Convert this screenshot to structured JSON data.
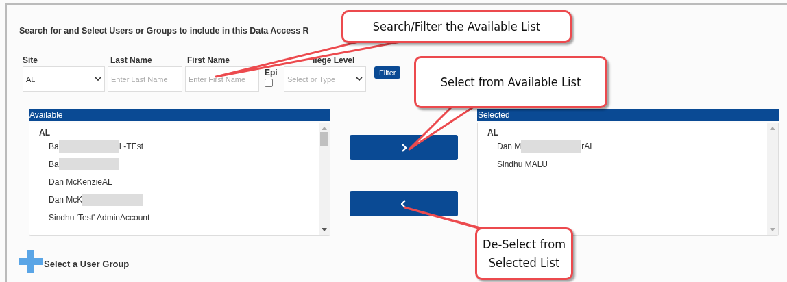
{
  "heading": "Search for and Select Users or Groups to include in this Data Access R",
  "filters": {
    "site": {
      "label": "Site",
      "value": "AL"
    },
    "last_name": {
      "label": "Last Name",
      "placeholder": "Enter Last Name"
    },
    "first_name": {
      "label": "First Name",
      "placeholder": "Enter First Name"
    },
    "epi": {
      "label": "Epi",
      "checked": false
    },
    "privilege": {
      "label": "ilege Level",
      "placeholder": "Select or Type"
    },
    "filter_button": "Filter"
  },
  "available": {
    "title": "Available",
    "groups": [
      {
        "name": "AL",
        "items": [
          {
            "prefix": "Ba",
            "redacted": true,
            "suffix": "L-TEst"
          },
          {
            "prefix": "Ba",
            "redacted": true
          },
          {
            "prefix": "Dan McKenzieAL",
            "redacted": false
          },
          {
            "prefix": "Dan McK",
            "redacted": true
          },
          {
            "prefix": "Sindhu 'Test' AdminAccount",
            "redacted": false
          }
        ]
      }
    ]
  },
  "move_buttons": [
    {
      "kind": "add"
    },
    {
      "kind": "remove"
    }
  ],
  "selected": {
    "title": "Selected",
    "groups": [
      {
        "name": "AL",
        "items": [
          {
            "prefix": "Dan M",
            "redacted": true,
            "suffix": "rAL"
          },
          {
            "prefix": "Sindhu MALU",
            "redacted": false
          }
        ]
      }
    ]
  },
  "user_group_link": "Select a User Group",
  "callouts": [
    "Search/Filter the Available List",
    "Select from Available List",
    "De-Select from\nSelected List"
  ]
}
